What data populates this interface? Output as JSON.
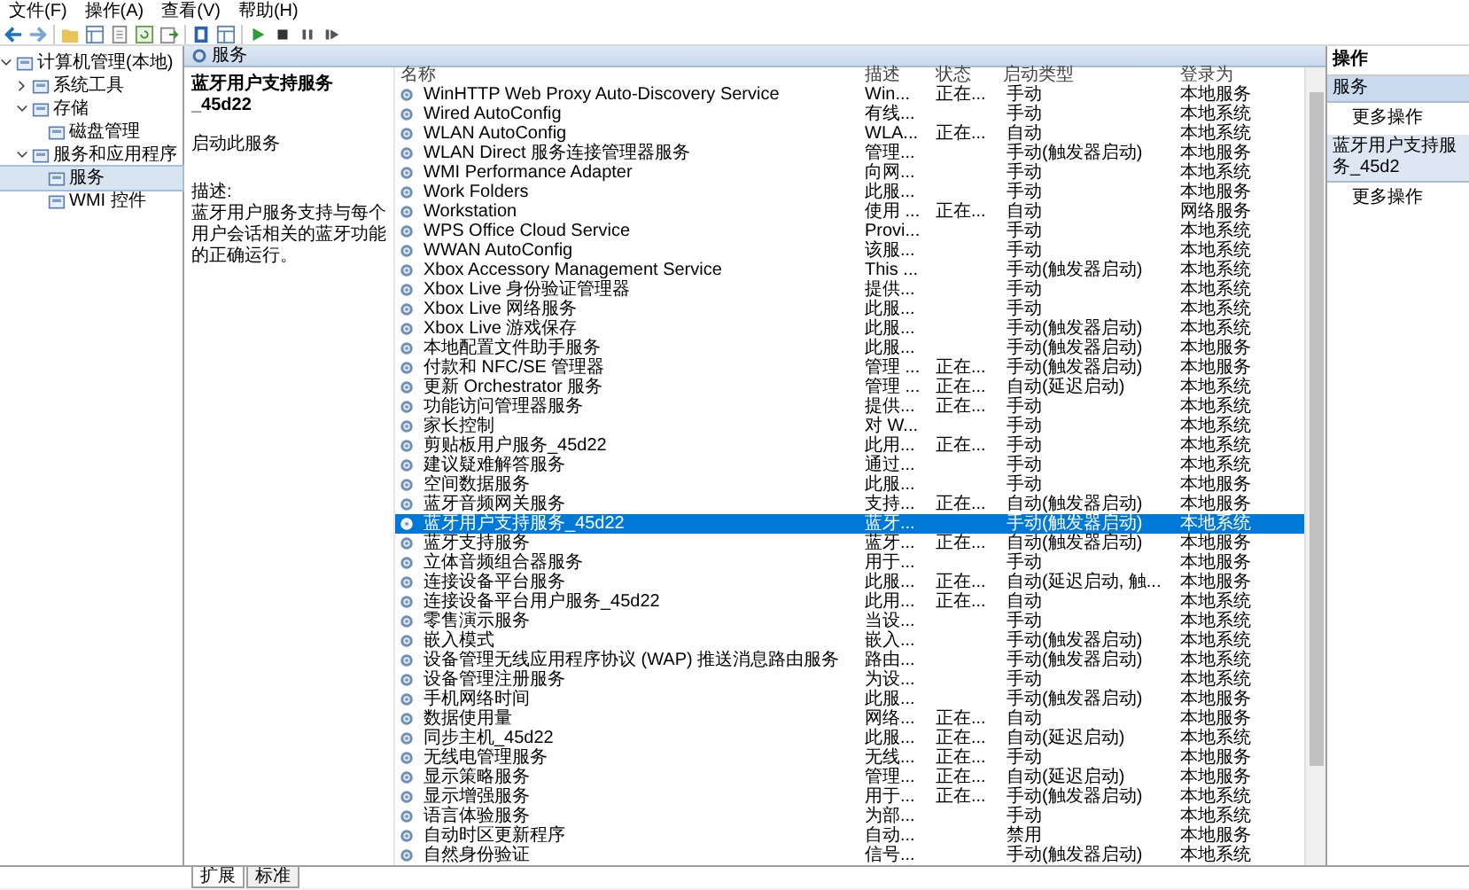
{
  "menu": [
    "文件(F)",
    "操作(A)",
    "查看(V)",
    "帮助(H)"
  ],
  "tree": [
    {
      "label": "计算机管理(本地)",
      "expanded": true,
      "selected": false,
      "children": [
        {
          "label": "系统工具",
          "expanded": false,
          "selected": false
        },
        {
          "label": "存储",
          "expanded": true,
          "selected": false,
          "children": [
            {
              "label": "磁盘管理",
              "selected": false
            }
          ]
        },
        {
          "label": "服务和应用程序",
          "expanded": true,
          "selected": false,
          "children": [
            {
              "label": "服务",
              "selected": true
            },
            {
              "label": "WMI 控件",
              "selected": false
            }
          ]
        }
      ]
    }
  ],
  "panel_title": "服务",
  "description": {
    "title": "蓝牙用户支持服务_45d22",
    "action_link": "启动",
    "action_text": "此服务",
    "heading": "描述:",
    "text": "蓝牙用户服务支持与每个用户会话相关的蓝牙功能的正确运行。"
  },
  "table": {
    "columns": [
      "名称",
      "描述",
      "状态",
      "启动类型",
      "登录为"
    ],
    "rows": [
      {
        "name": "WinHTTP Web Proxy Auto-Discovery Service",
        "description": "Win...",
        "status": "正在...",
        "startup_type": "手动",
        "log_on_as": "本地服务",
        "selected": false
      },
      {
        "name": "Wired AutoConfig",
        "description": "有线...",
        "startup_type": "手动",
        "log_on_as": "本地系统",
        "selected": false
      },
      {
        "name": "WLAN AutoConfig",
        "description": "WLA...",
        "status": "正在...",
        "startup_type": "自动",
        "log_on_as": "本地系统",
        "selected": false
      },
      {
        "name": "WLAN Direct 服务连接管理器服务",
        "description": "管理...",
        "startup_type": "手动(触发器启动)",
        "log_on_as": "本地服务",
        "selected": false
      },
      {
        "name": "WMI Performance Adapter",
        "description": "向网...",
        "startup_type": "手动",
        "log_on_as": "本地系统",
        "selected": false
      },
      {
        "name": "Work Folders",
        "description": "此服...",
        "startup_type": "手动",
        "log_on_as": "本地服务",
        "selected": false
      },
      {
        "name": "Workstation",
        "description": "使用 ...",
        "status": "正在...",
        "startup_type": "自动",
        "log_on_as": "网络服务",
        "selected": false
      },
      {
        "name": "WPS Office Cloud Service",
        "description": "Provi...",
        "startup_type": "手动",
        "log_on_as": "本地系统",
        "selected": false
      },
      {
        "name": "WWAN AutoConfig",
        "description": "该服...",
        "startup_type": "手动",
        "log_on_as": "本地系统",
        "selected": false
      },
      {
        "name": "Xbox Accessory Management Service",
        "description": "This ...",
        "startup_type": "手动(触发器启动)",
        "log_on_as": "本地系统",
        "selected": false
      },
      {
        "name": "Xbox Live 身份验证管理器",
        "description": "提供...",
        "startup_type": "手动",
        "log_on_as": "本地系统",
        "selected": false
      },
      {
        "name": "Xbox Live 网络服务",
        "description": "此服...",
        "startup_type": "手动",
        "log_on_as": "本地系统",
        "selected": false
      },
      {
        "name": "Xbox Live 游戏保存",
        "description": "此服...",
        "startup_type": "手动(触发器启动)",
        "log_on_as": "本地系统",
        "selected": false
      },
      {
        "name": "本地配置文件助手服务",
        "description": "此服...",
        "startup_type": "手动(触发器启动)",
        "log_on_as": "本地服务",
        "selected": false
      },
      {
        "name": "付款和 NFC/SE 管理器",
        "description": "管理 ...",
        "status": "正在...",
        "startup_type": "手动(触发器启动)",
        "log_on_as": "本地服务",
        "selected": false
      },
      {
        "name": "更新 Orchestrator 服务",
        "description": "管理 ...",
        "status": "正在...",
        "startup_type": "自动(延迟启动)",
        "log_on_as": "本地系统",
        "selected": false
      },
      {
        "name": "功能访问管理器服务",
        "description": "提供...",
        "status": "正在...",
        "startup_type": "手动",
        "log_on_as": "本地系统",
        "selected": false
      },
      {
        "name": "家长控制",
        "description": "对 W...",
        "startup_type": "手动",
        "log_on_as": "本地系统",
        "selected": false
      },
      {
        "name": "剪贴板用户服务_45d22",
        "description": "此用...",
        "status": "正在...",
        "startup_type": "手动",
        "log_on_as": "本地系统",
        "selected": false
      },
      {
        "name": "建议疑难解答服务",
        "description": "通过...",
        "startup_type": "手动",
        "log_on_as": "本地系统",
        "selected": false
      },
      {
        "name": "空间数据服务",
        "description": "此服...",
        "startup_type": "手动",
        "log_on_as": "本地服务",
        "selected": false
      },
      {
        "name": "蓝牙音频网关服务",
        "description": "支持...",
        "status": "正在...",
        "startup_type": "自动(触发器启动)",
        "log_on_as": "本地服务",
        "selected": false
      },
      {
        "name": "蓝牙用户支持服务_45d22",
        "description": "蓝牙...",
        "startup_type": "手动(触发器启动)",
        "log_on_as": "本地系统",
        "selected": true
      },
      {
        "name": "蓝牙支持服务",
        "description": "蓝牙...",
        "status": "正在...",
        "startup_type": "自动(触发器启动)",
        "log_on_as": "本地服务",
        "selected": false
      },
      {
        "name": "立体音频组合器服务",
        "description": "用于...",
        "startup_type": "手动",
        "log_on_as": "本地服务",
        "selected": false
      },
      {
        "name": "连接设备平台服务",
        "description": "此服...",
        "status": "正在...",
        "startup_type": "自动(延迟启动, 触...",
        "log_on_as": "本地服务",
        "selected": false
      },
      {
        "name": "连接设备平台用户服务_45d22",
        "description": "此用...",
        "status": "正在...",
        "startup_type": "自动",
        "log_on_as": "本地系统",
        "selected": false
      },
      {
        "name": "零售演示服务",
        "description": "当设...",
        "startup_type": "手动",
        "log_on_as": "本地系统",
        "selected": false
      },
      {
        "name": "嵌入模式",
        "description": "嵌入...",
        "startup_type": "手动(触发器启动)",
        "log_on_as": "本地系统",
        "selected": false
      },
      {
        "name": "设备管理无线应用程序协议 (WAP) 推送消息路由服务",
        "description": "路由...",
        "startup_type": "手动(触发器启动)",
        "log_on_as": "本地系统",
        "selected": false
      },
      {
        "name": "设备管理注册服务",
        "description": "为设...",
        "startup_type": "手动",
        "log_on_as": "本地系统",
        "selected": false
      },
      {
        "name": "手机网络时间",
        "description": "此服...",
        "startup_type": "手动(触发器启动)",
        "log_on_as": "本地服务",
        "selected": false
      },
      {
        "name": "数据使用量",
        "description": "网络...",
        "status": "正在...",
        "startup_type": "自动",
        "log_on_as": "本地服务",
        "selected": false
      },
      {
        "name": "同步主机_45d22",
        "description": "此服...",
        "status": "正在...",
        "startup_type": "自动(延迟启动)",
        "log_on_as": "本地系统",
        "selected": false
      },
      {
        "name": "无线电管理服务",
        "description": "无线...",
        "status": "正在...",
        "startup_type": "手动",
        "log_on_as": "本地服务",
        "selected": false
      },
      {
        "name": "显示策略服务",
        "description": "管理...",
        "status": "正在...",
        "startup_type": "自动(延迟启动)",
        "log_on_as": "本地服务",
        "selected": false
      },
      {
        "name": "显示增强服务",
        "description": "用于...",
        "status": "正在...",
        "startup_type": "手动(触发器启动)",
        "log_on_as": "本地系统",
        "selected": false
      },
      {
        "name": "语言体验服务",
        "description": "为部...",
        "startup_type": "手动",
        "log_on_as": "本地系统",
        "selected": false
      },
      {
        "name": "自动时区更新程序",
        "description": "自动...",
        "startup_type": "禁用",
        "log_on_as": "本地服务",
        "selected": false
      },
      {
        "name": "自然身份验证",
        "description": "信号...",
        "startup_type": "手动(触发器启动)",
        "log_on_as": "本地系统",
        "selected": false
      }
    ]
  },
  "actions": {
    "title": "操作",
    "sections": [
      {
        "title": "服务",
        "items": [
          "更多操作"
        ]
      },
      {
        "title": "蓝牙用户支持服务_45d2",
        "items": [
          "更多操作"
        ]
      }
    ]
  },
  "bottom_tabs": [
    {
      "label": "扩展",
      "selected": true
    },
    {
      "label": "标准",
      "selected": false
    }
  ]
}
